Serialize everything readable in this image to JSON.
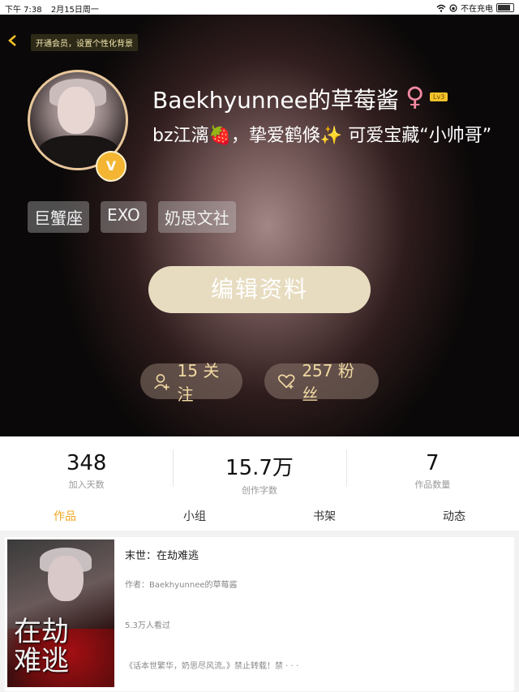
{
  "status_bar": {
    "time": "下午 7:38",
    "date": "2月15日周一",
    "network_status": "不在充电"
  },
  "header": {
    "vip_banner": "开通会员，设置个性化背景"
  },
  "profile": {
    "username": "Baekhyunnee的草莓酱",
    "gender_symbol": "♀",
    "level": "Lv3",
    "vip_badge": "V",
    "bio": "bz江漓🍓，挚爱鹤倏✨  可爱宝藏“小帅哥”",
    "tags": [
      "巨蟹座",
      "EXO",
      "奶思文社"
    ],
    "edit_button": "编辑资料",
    "following_label": "15 关注",
    "fans_label": "257 粉丝"
  },
  "stats": [
    {
      "value": "348",
      "label": "加入天数"
    },
    {
      "value": "15.7万",
      "label": "创作字数"
    },
    {
      "value": "7",
      "label": "作品数量"
    }
  ],
  "tabs": [
    "作品",
    "小组",
    "书架",
    "动态"
  ],
  "active_tab": "作品",
  "work": {
    "title": "末世：在劫难逃",
    "author": "作者：Baekhyunnee的草莓酱",
    "views": "5.3万人看过",
    "description": "《话本世繁华，奶思尽风流。》禁止转载！禁 · · ·",
    "cover_title": "在劫难逃"
  },
  "colors": {
    "accent": "#f0a820",
    "button_bg": "#e7dcc0",
    "gender": "#f38aa3"
  }
}
